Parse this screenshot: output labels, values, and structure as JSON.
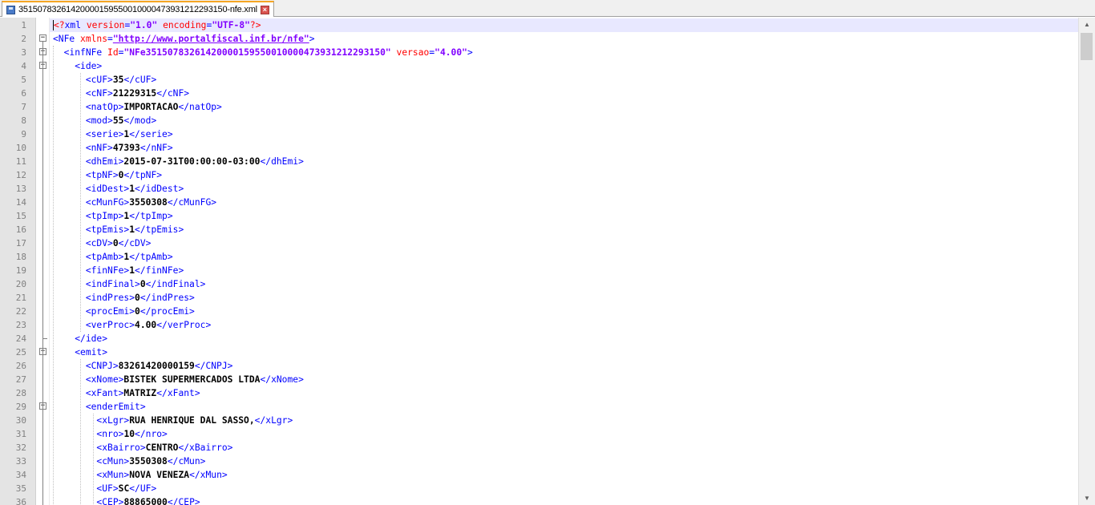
{
  "tab": {
    "title": "35150783261420000159550010000473931212293150-nfe.xml",
    "save_icon": "floppy-disk-icon",
    "close_icon": "close-icon"
  },
  "lines": [
    {
      "n": "1",
      "code": [
        [
          "pi",
          "<?"
        ],
        [
          "t",
          "xml "
        ],
        [
          "a",
          "version"
        ],
        [
          "t",
          "="
        ],
        [
          "v",
          "\"1.0\""
        ],
        [
          "t",
          " "
        ],
        [
          "a",
          "encoding"
        ],
        [
          "t",
          "="
        ],
        [
          "v",
          "\"UTF-8\""
        ],
        [
          "pi",
          "?>"
        ]
      ]
    },
    {
      "n": "2",
      "code": [
        [
          "t",
          "<NFe "
        ],
        [
          "a",
          "xmlns"
        ],
        [
          "t",
          "="
        ],
        [
          "vu",
          "\"http://www.portalfiscal.inf.br/nfe\""
        ],
        [
          "t",
          ">"
        ]
      ]
    },
    {
      "n": "3",
      "code": [
        [
          "s",
          "  "
        ],
        [
          "t",
          "<infNFe "
        ],
        [
          "a",
          "Id"
        ],
        [
          "t",
          "="
        ],
        [
          "v",
          "\"NFe35150783261420000159550010000473931212293150\""
        ],
        [
          "t",
          " "
        ],
        [
          "a",
          "versao"
        ],
        [
          "t",
          "="
        ],
        [
          "v",
          "\"4.00\""
        ],
        [
          "t",
          ">"
        ]
      ]
    },
    {
      "n": "4",
      "code": [
        [
          "s",
          "    "
        ],
        [
          "t",
          "<ide>"
        ]
      ]
    },
    {
      "n": "5",
      "code": [
        [
          "s",
          "      "
        ],
        [
          "t",
          "<cUF>"
        ],
        [
          "tx",
          "35"
        ],
        [
          "t",
          "</cUF>"
        ]
      ]
    },
    {
      "n": "6",
      "code": [
        [
          "s",
          "      "
        ],
        [
          "t",
          "<cNF>"
        ],
        [
          "tx",
          "21229315"
        ],
        [
          "t",
          "</cNF>"
        ]
      ]
    },
    {
      "n": "7",
      "code": [
        [
          "s",
          "      "
        ],
        [
          "t",
          "<natOp>"
        ],
        [
          "tx",
          "IMPORTACAO"
        ],
        [
          "t",
          "</natOp>"
        ]
      ]
    },
    {
      "n": "8",
      "code": [
        [
          "s",
          "      "
        ],
        [
          "t",
          "<mod>"
        ],
        [
          "tx",
          "55"
        ],
        [
          "t",
          "</mod>"
        ]
      ]
    },
    {
      "n": "9",
      "code": [
        [
          "s",
          "      "
        ],
        [
          "t",
          "<serie>"
        ],
        [
          "tx",
          "1"
        ],
        [
          "t",
          "</serie>"
        ]
      ]
    },
    {
      "n": "10",
      "code": [
        [
          "s",
          "      "
        ],
        [
          "t",
          "<nNF>"
        ],
        [
          "tx",
          "47393"
        ],
        [
          "t",
          "</nNF>"
        ]
      ]
    },
    {
      "n": "11",
      "code": [
        [
          "s",
          "      "
        ],
        [
          "t",
          "<dhEmi>"
        ],
        [
          "tx",
          "2015-07-31T00:00:00-03:00"
        ],
        [
          "t",
          "</dhEmi>"
        ]
      ]
    },
    {
      "n": "12",
      "code": [
        [
          "s",
          "      "
        ],
        [
          "t",
          "<tpNF>"
        ],
        [
          "tx",
          "0"
        ],
        [
          "t",
          "</tpNF>"
        ]
      ]
    },
    {
      "n": "13",
      "code": [
        [
          "s",
          "      "
        ],
        [
          "t",
          "<idDest>"
        ],
        [
          "tx",
          "1"
        ],
        [
          "t",
          "</idDest>"
        ]
      ]
    },
    {
      "n": "14",
      "code": [
        [
          "s",
          "      "
        ],
        [
          "t",
          "<cMunFG>"
        ],
        [
          "tx",
          "3550308"
        ],
        [
          "t",
          "</cMunFG>"
        ]
      ]
    },
    {
      "n": "15",
      "code": [
        [
          "s",
          "      "
        ],
        [
          "t",
          "<tpImp>"
        ],
        [
          "tx",
          "1"
        ],
        [
          "t",
          "</tpImp>"
        ]
      ]
    },
    {
      "n": "16",
      "code": [
        [
          "s",
          "      "
        ],
        [
          "t",
          "<tpEmis>"
        ],
        [
          "tx",
          "1"
        ],
        [
          "t",
          "</tpEmis>"
        ]
      ]
    },
    {
      "n": "17",
      "code": [
        [
          "s",
          "      "
        ],
        [
          "t",
          "<cDV>"
        ],
        [
          "tx",
          "0"
        ],
        [
          "t",
          "</cDV>"
        ]
      ]
    },
    {
      "n": "18",
      "code": [
        [
          "s",
          "      "
        ],
        [
          "t",
          "<tpAmb>"
        ],
        [
          "tx",
          "1"
        ],
        [
          "t",
          "</tpAmb>"
        ]
      ]
    },
    {
      "n": "19",
      "code": [
        [
          "s",
          "      "
        ],
        [
          "t",
          "<finNFe>"
        ],
        [
          "tx",
          "1"
        ],
        [
          "t",
          "</finNFe>"
        ]
      ]
    },
    {
      "n": "20",
      "code": [
        [
          "s",
          "      "
        ],
        [
          "t",
          "<indFinal>"
        ],
        [
          "tx",
          "0"
        ],
        [
          "t",
          "</indFinal>"
        ]
      ]
    },
    {
      "n": "21",
      "code": [
        [
          "s",
          "      "
        ],
        [
          "t",
          "<indPres>"
        ],
        [
          "tx",
          "0"
        ],
        [
          "t",
          "</indPres>"
        ]
      ]
    },
    {
      "n": "22",
      "code": [
        [
          "s",
          "      "
        ],
        [
          "t",
          "<procEmi>"
        ],
        [
          "tx",
          "0"
        ],
        [
          "t",
          "</procEmi>"
        ]
      ]
    },
    {
      "n": "23",
      "code": [
        [
          "s",
          "      "
        ],
        [
          "t",
          "<verProc>"
        ],
        [
          "tx",
          "4.00"
        ],
        [
          "t",
          "</verProc>"
        ]
      ]
    },
    {
      "n": "24",
      "code": [
        [
          "s",
          "    "
        ],
        [
          "t",
          "</ide>"
        ]
      ]
    },
    {
      "n": "25",
      "code": [
        [
          "s",
          "    "
        ],
        [
          "t",
          "<emit>"
        ]
      ]
    },
    {
      "n": "26",
      "code": [
        [
          "s",
          "      "
        ],
        [
          "t",
          "<CNPJ>"
        ],
        [
          "tx",
          "83261420000159"
        ],
        [
          "t",
          "</CNPJ>"
        ]
      ]
    },
    {
      "n": "27",
      "code": [
        [
          "s",
          "      "
        ],
        [
          "t",
          "<xNome>"
        ],
        [
          "tx",
          "BISTEK SUPERMERCADOS LTDA"
        ],
        [
          "t",
          "</xNome>"
        ]
      ]
    },
    {
      "n": "28",
      "code": [
        [
          "s",
          "      "
        ],
        [
          "t",
          "<xFant>"
        ],
        [
          "tx",
          "MATRIZ"
        ],
        [
          "t",
          "</xFant>"
        ]
      ]
    },
    {
      "n": "29",
      "code": [
        [
          "s",
          "      "
        ],
        [
          "t",
          "<enderEmit>"
        ]
      ]
    },
    {
      "n": "30",
      "code": [
        [
          "s",
          "        "
        ],
        [
          "t",
          "<xLgr>"
        ],
        [
          "tx",
          "RUA HENRIQUE DAL SASSO,"
        ],
        [
          "t",
          "</xLgr>"
        ]
      ]
    },
    {
      "n": "31",
      "code": [
        [
          "s",
          "        "
        ],
        [
          "t",
          "<nro>"
        ],
        [
          "tx",
          "10"
        ],
        [
          "t",
          "</nro>"
        ]
      ]
    },
    {
      "n": "32",
      "code": [
        [
          "s",
          "        "
        ],
        [
          "t",
          "<xBairro>"
        ],
        [
          "tx",
          "CENTRO"
        ],
        [
          "t",
          "</xBairro>"
        ]
      ]
    },
    {
      "n": "33",
      "code": [
        [
          "s",
          "        "
        ],
        [
          "t",
          "<cMun>"
        ],
        [
          "tx",
          "3550308"
        ],
        [
          "t",
          "</cMun>"
        ]
      ]
    },
    {
      "n": "34",
      "code": [
        [
          "s",
          "        "
        ],
        [
          "t",
          "<xMun>"
        ],
        [
          "tx",
          "NOVA VENEZA"
        ],
        [
          "t",
          "</xMun>"
        ]
      ]
    },
    {
      "n": "35",
      "code": [
        [
          "s",
          "        "
        ],
        [
          "t",
          "<UF>"
        ],
        [
          "tx",
          "SC"
        ],
        [
          "t",
          "</UF>"
        ]
      ]
    },
    {
      "n": "36",
      "code": [
        [
          "s",
          "        "
        ],
        [
          "t",
          "<CEP>"
        ],
        [
          "tx",
          "88865000"
        ],
        [
          "t",
          "</CEP>"
        ]
      ]
    }
  ]
}
